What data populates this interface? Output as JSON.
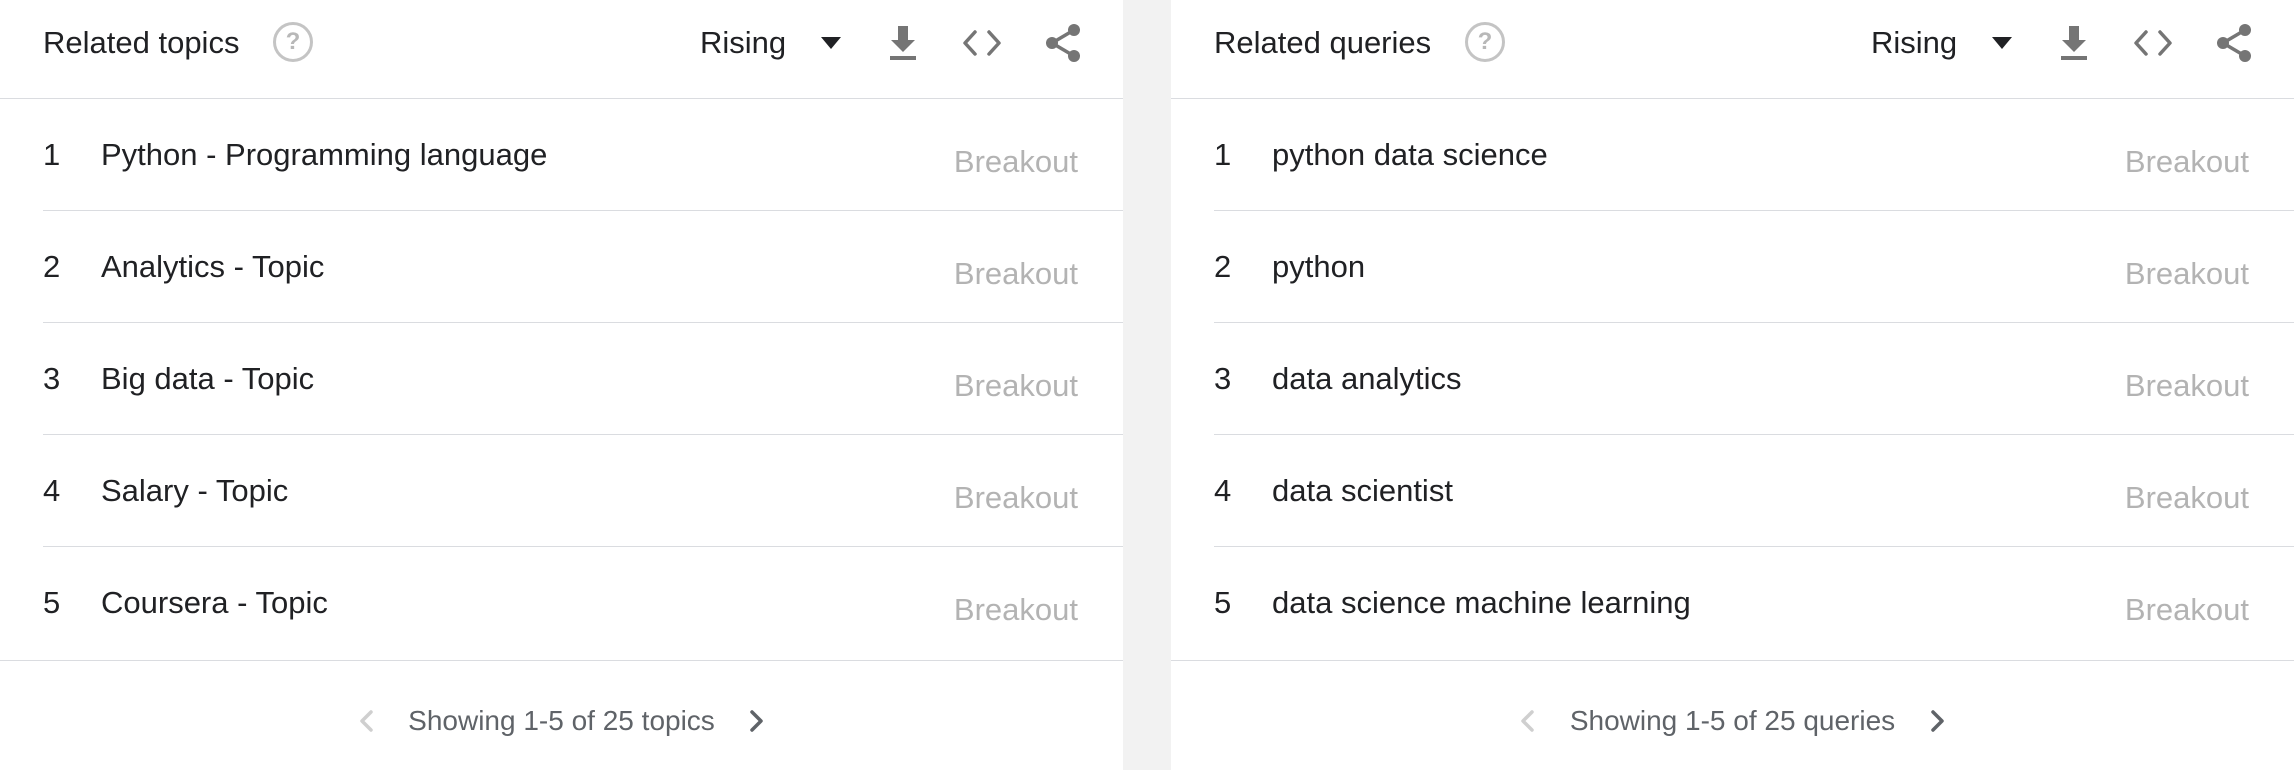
{
  "widgets": [
    {
      "title": "Related topics",
      "help_icon": "help-circle-icon",
      "help_glyph": "?",
      "selector": "Rising",
      "toolbar_icons": [
        "download-icon",
        "embed-code-icon",
        "share-icon"
      ],
      "items": [
        {
          "rank": "1",
          "name": "Python - Programming language",
          "value": "Breakout"
        },
        {
          "rank": "2",
          "name": "Analytics - Topic",
          "value": "Breakout"
        },
        {
          "rank": "3",
          "name": "Big data - Topic",
          "value": "Breakout"
        },
        {
          "rank": "4",
          "name": "Salary - Topic",
          "value": "Breakout"
        },
        {
          "rank": "5",
          "name": "Coursera - Topic",
          "value": "Breakout"
        }
      ],
      "pagination": "Showing 1-5 of 25 topics"
    },
    {
      "title": "Related queries",
      "help_icon": "help-circle-icon",
      "help_glyph": "?",
      "selector": "Rising",
      "toolbar_icons": [
        "download-icon",
        "embed-code-icon",
        "share-icon"
      ],
      "items": [
        {
          "rank": "1",
          "name": "python data science",
          "value": "Breakout"
        },
        {
          "rank": "2",
          "name": "python",
          "value": "Breakout"
        },
        {
          "rank": "3",
          "name": "data analytics",
          "value": "Breakout"
        },
        {
          "rank": "4",
          "name": "data scientist",
          "value": "Breakout"
        },
        {
          "rank": "5",
          "name": "data science machine learning",
          "value": "Breakout"
        }
      ],
      "pagination": "Showing 1-5 of 25 queries"
    }
  ],
  "colors": {
    "text": "#202124",
    "muted_value": "#b3b3b3",
    "divider": "#dadce0",
    "icon": "#757575",
    "page_background": "#f2f2f2"
  }
}
